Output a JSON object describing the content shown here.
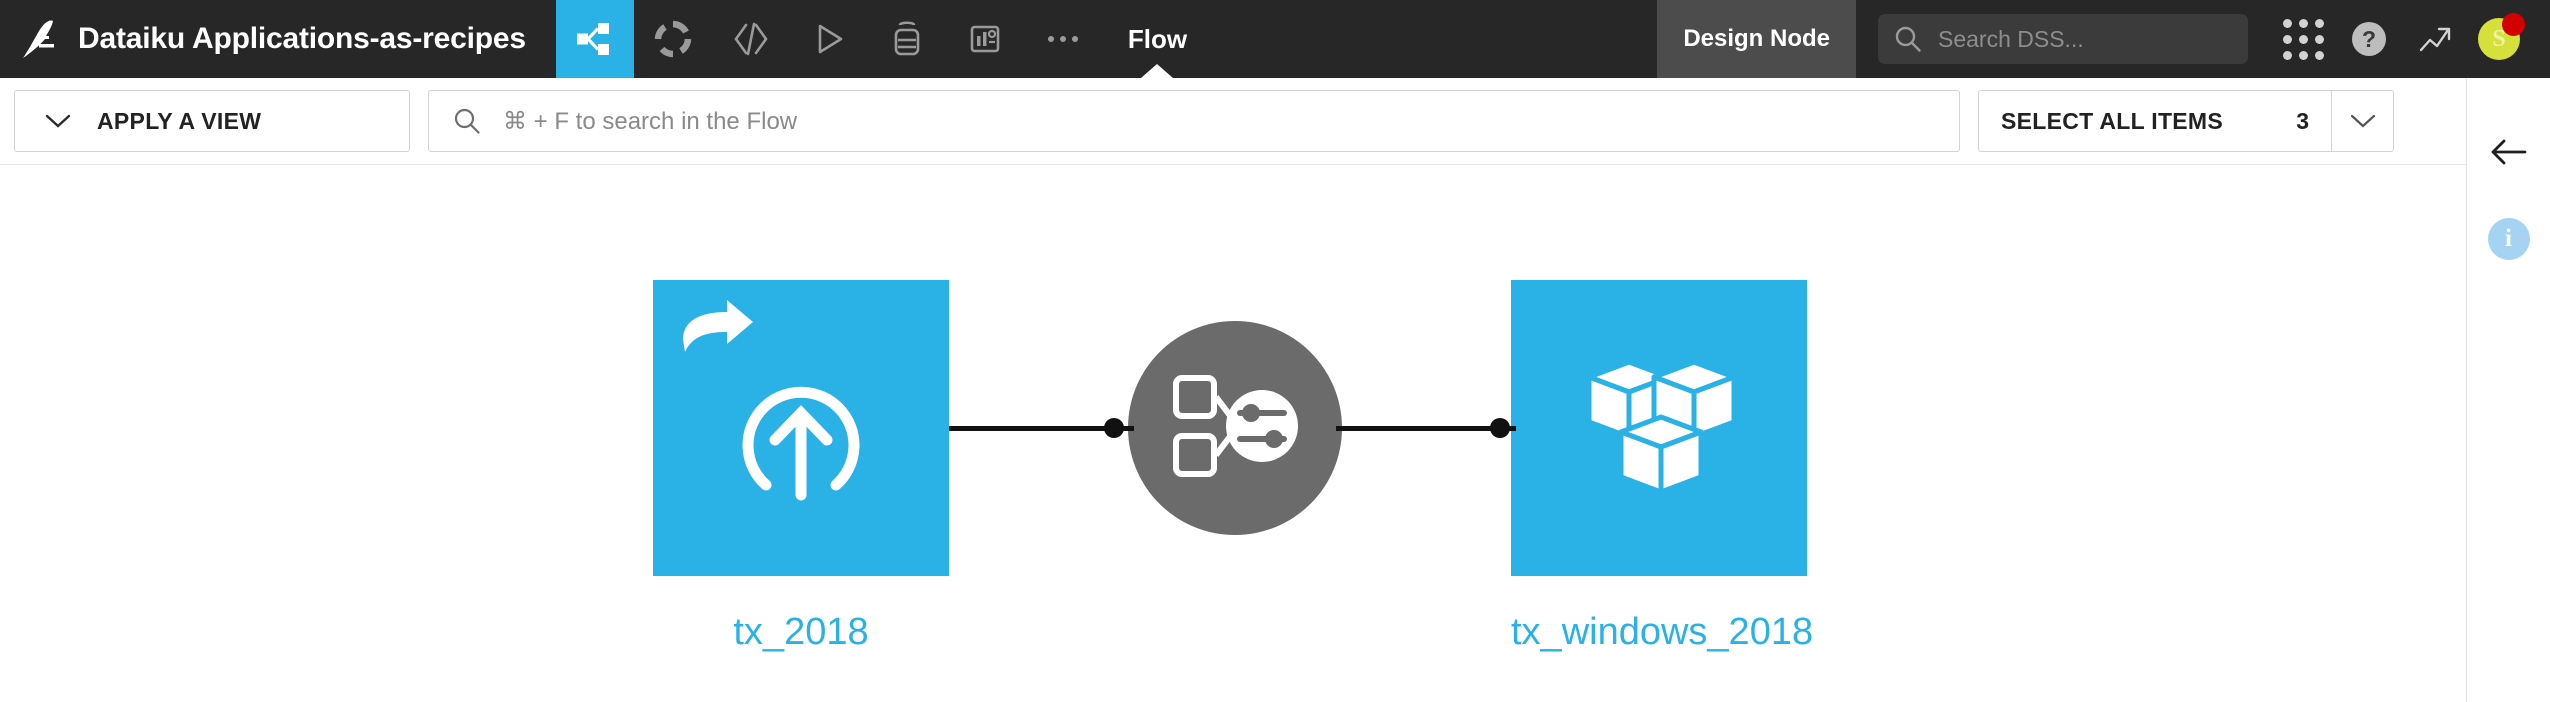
{
  "header": {
    "logo_icon": "dataiku-bird-logo",
    "project_title": "Dataiku Applications-as-recipes",
    "nav_icons": [
      {
        "name": "flow-icon",
        "label": "Flow",
        "active": true
      },
      {
        "name": "dashboard-icon",
        "label": "Dashboards",
        "active": false
      },
      {
        "name": "code-icon",
        "label": "Code",
        "active": false
      },
      {
        "name": "run-icon",
        "label": "Jobs",
        "active": false
      },
      {
        "name": "lab-icon",
        "label": "Lab",
        "active": false
      },
      {
        "name": "wiki-icon",
        "label": "Wiki",
        "active": false
      },
      {
        "name": "more-icon",
        "label": "More",
        "active": false
      }
    ],
    "current_tab": "Flow",
    "node_badge": "Design Node",
    "search": {
      "placeholder": "Search DSS...",
      "value": "",
      "icon": "search-icon"
    },
    "right_icons": [
      {
        "name": "apps-grid-icon"
      },
      {
        "name": "help-icon",
        "glyph": "?"
      },
      {
        "name": "trending-up-icon"
      }
    ],
    "avatar": {
      "initial": "S",
      "color": "#d6e03a",
      "badge_color": "#d40000"
    }
  },
  "toolbar": {
    "apply_view_label": "APPLY A VIEW",
    "apply_view_icon": "chevron-down-icon",
    "flow_search_placeholder": "⌘ + F to search in the Flow",
    "flow_search_icon": "search-icon",
    "select_all_label": "SELECT ALL ITEMS",
    "select_all_count": "3",
    "select_all_caret_icon": "chevron-down-icon"
  },
  "right_panel": {
    "collapse_icon": "arrow-left-icon",
    "info_icon": "info-icon",
    "info_glyph": "i"
  },
  "flow": {
    "nodes": [
      {
        "id": "tx_2018",
        "label": "tx_2018",
        "type": "dataset",
        "icon": "upload-dataset-icon",
        "shared": true,
        "color": "#2ab1e5"
      },
      {
        "id": "app_recipe",
        "label": "",
        "type": "recipe",
        "icon": "application-as-recipe-icon",
        "color": "#6b6b6b"
      },
      {
        "id": "tx_windows_2018",
        "label": "tx_windows_2018",
        "type": "dataset",
        "icon": "managed-dataset-cubes-icon",
        "color": "#2ab1e5"
      }
    ],
    "edges": [
      {
        "from": "tx_2018",
        "to": "app_recipe"
      },
      {
        "from": "app_recipe",
        "to": "tx_windows_2018"
      }
    ]
  },
  "colors": {
    "accent": "#2ab1e5",
    "header_bg": "#272727",
    "recipe_gray": "#6b6b6b",
    "badge_bg": "#4c4c4c"
  }
}
